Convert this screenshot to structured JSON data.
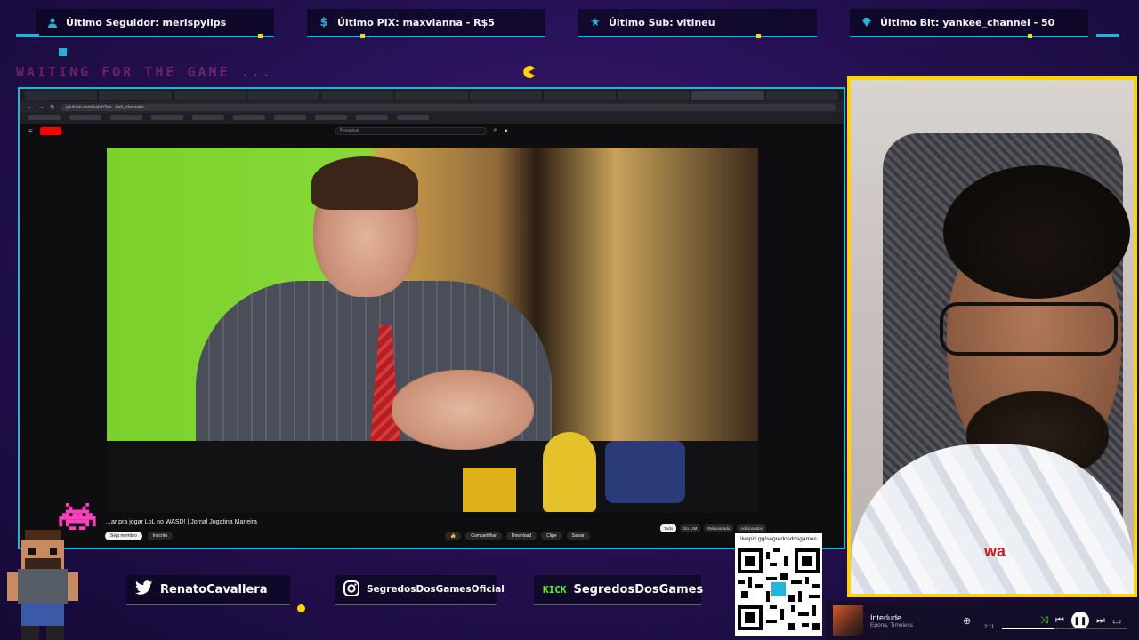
{
  "alerts": [
    {
      "label": "Último Seguidor: merispylips",
      "icon": "user-icon"
    },
    {
      "label": "Último PIX: maxvianna - R$5",
      "icon": "dollar-icon"
    },
    {
      "label": "Último Sub: vitineu",
      "icon": "star-icon"
    },
    {
      "label": "Último Bit: yankee_channel - 50",
      "icon": "diamond-icon"
    }
  ],
  "waiting_text": "WAITING FOR THE GAME ...",
  "browser": {
    "url": "youtube.com/watch?v=...&ab_channel=...",
    "search_placeholder": "Pesquisar",
    "video_title": "…ar pra jogar LoL no WASD! | Jornal Jogatina Maneira",
    "subscribe_label": "Seja membro",
    "subscribed_label": "Inscrito",
    "actions": [
      "Compartilhar",
      "Download",
      "Clipe",
      "Salvar"
    ],
    "chips": [
      "Tudo",
      "Do JJM",
      "Relacionado",
      "Adicionados"
    ],
    "qr_caption": "livepix.gg/segredosdosgames"
  },
  "social": {
    "twitter": "RenatoCavallera",
    "instagram": "SegredosDosGamesOficial",
    "kick_label": "KICK",
    "kick": "SegredosDosGames"
  },
  "music": {
    "track": "Interlude",
    "artist": "Epona, Timeless",
    "time": "2:11",
    "progress": 0.42
  },
  "colors": {
    "accent_cyan": "#1fb7d9",
    "cam_border": "#ffd400",
    "kick_green": "#53fc18"
  }
}
